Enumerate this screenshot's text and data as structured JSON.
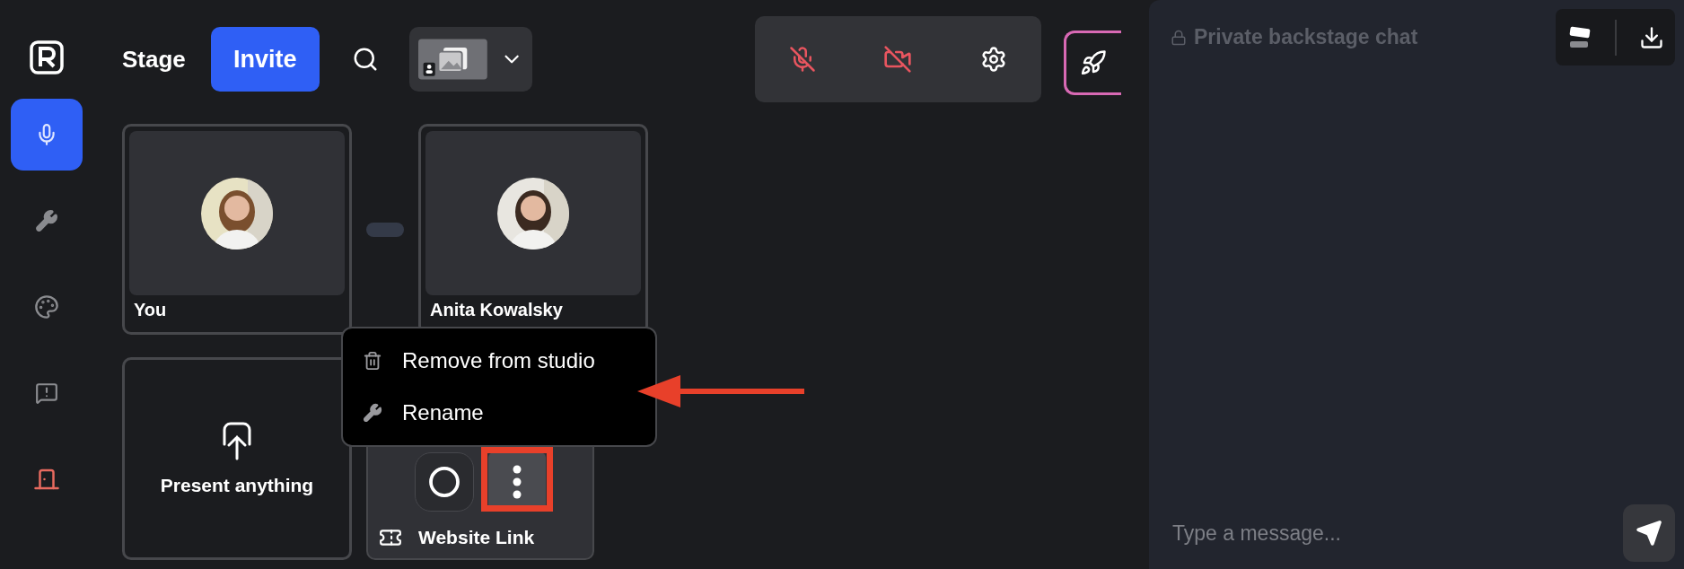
{
  "sidebar": {
    "items": [
      {
        "kind": "stage",
        "selected": true
      },
      {
        "kind": "tools",
        "selected": false
      },
      {
        "kind": "brand",
        "selected": false
      },
      {
        "kind": "feedback",
        "selected": false
      },
      {
        "kind": "leave",
        "selected": false
      }
    ]
  },
  "header": {
    "title": "Stage",
    "invite_button": "Invite"
  },
  "controls": {
    "mic_muted": true,
    "camera_off": true
  },
  "participants": [
    {
      "name": "You"
    },
    {
      "name": "Anita Kowalsky"
    }
  ],
  "present_card": {
    "label": "Present anything"
  },
  "source_card": {
    "label": "Website Link"
  },
  "context_menu": {
    "items": [
      {
        "kind": "remove",
        "label": "Remove from studio"
      },
      {
        "kind": "rename",
        "label": "Rename"
      }
    ]
  },
  "chat": {
    "title": "Private backstage chat",
    "placeholder": "Type a message..."
  }
}
